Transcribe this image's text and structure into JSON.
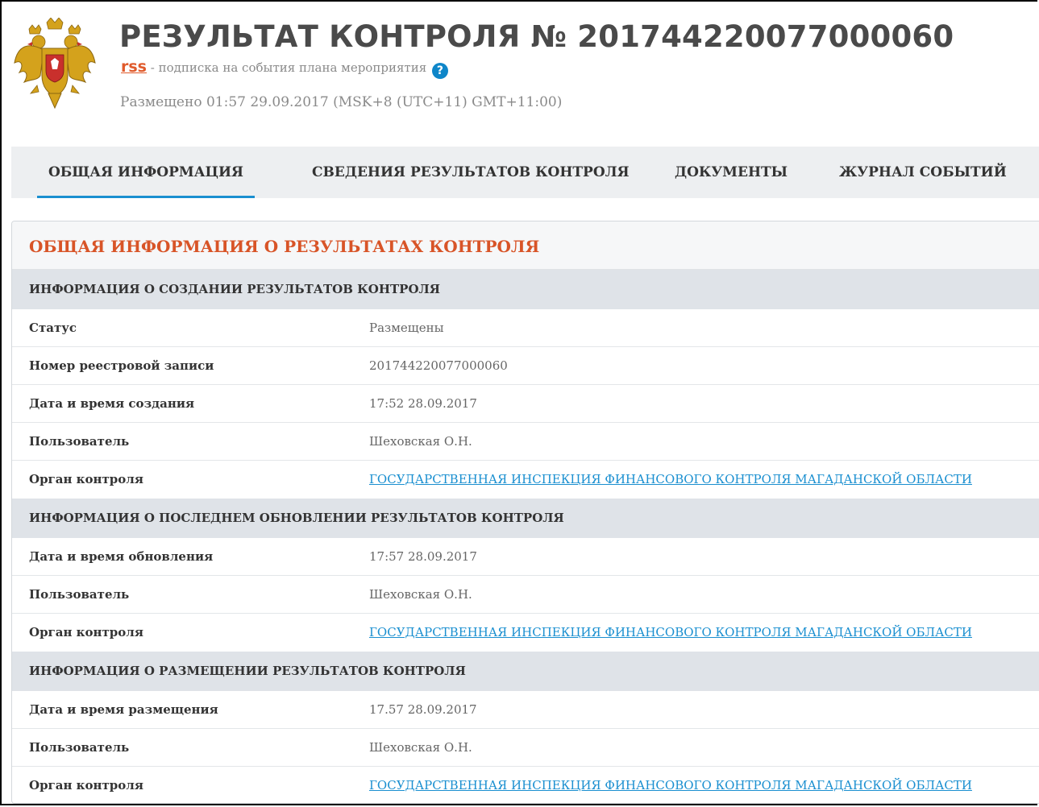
{
  "header": {
    "title": "РЕЗУЛЬТАТ КОНТРОЛЯ № 201744220077000060",
    "rss_label": "rss",
    "rss_description": " - подписка на события плана мероприятия",
    "help_icon_glyph": "?",
    "posted": "Размещено 01:57 29.09.2017 (MSK+8 (UTC+11) GMT+11:00)"
  },
  "tabs": [
    {
      "label": "ОБЩАЯ ИНФОРМАЦИЯ",
      "active": true
    },
    {
      "label": "СВЕДЕНИЯ РЕЗУЛЬТАТОВ КОНТРОЛЯ",
      "active": false
    },
    {
      "label": "ДОКУМЕНТЫ",
      "active": false
    },
    {
      "label": "ЖУРНАЛ СОБЫТИЙ",
      "active": false
    }
  ],
  "card": {
    "title": "ОБЩАЯ ИНФОРМАЦИЯ О РЕЗУЛЬТАТАХ КОНТРОЛЯ",
    "sections": [
      {
        "title": "ИНФОРМАЦИЯ О СОЗДАНИИ РЕЗУЛЬТАТОВ КОНТРОЛЯ",
        "rows": [
          {
            "label": "Статус",
            "value": "Размещены"
          },
          {
            "label": "Номер реестровой записи",
            "value": "201744220077000060"
          },
          {
            "label": "Дата и время создания",
            "value": "17:52 28.09.2017"
          },
          {
            "label": "Пользователь",
            "value": "Шеховская О.Н."
          },
          {
            "label": "Орган контроля",
            "value": "ГОСУДАРСТВЕННАЯ ИНСПЕКЦИЯ ФИНАНСОВОГО КОНТРОЛЯ МАГАДАНСКОЙ ОБЛАСТИ"
          }
        ]
      },
      {
        "title": "ИНФОРМАЦИЯ О ПОСЛЕДНЕМ ОБНОВЛЕНИИ РЕЗУЛЬТАТОВ КОНТРОЛЯ",
        "rows": [
          {
            "label": "Дата и время обновления",
            "value": "17:57 28.09.2017"
          },
          {
            "label": "Пользователь",
            "value": "Шеховская О.Н."
          },
          {
            "label": "Орган контроля",
            "value": "ГОСУДАРСТВЕННАЯ ИНСПЕКЦИЯ ФИНАНСОВОГО КОНТРОЛЯ МАГАДАНСКОЙ ОБЛАСТИ"
          }
        ]
      },
      {
        "title": "ИНФОРМАЦИЯ О РАЗМЕЩЕНИИ РЕЗУЛЬТАТОВ КОНТРОЛЯ",
        "rows": [
          {
            "label": "Дата и время размещения",
            "value": "17.57 28.09.2017"
          },
          {
            "label": "Пользователь",
            "value": "Шеховская О.Н."
          },
          {
            "label": "Орган контроля",
            "value": "ГОСУДАРСТВЕННАЯ ИНСПЕКЦИЯ ФИНАНСОВОГО КОНТРОЛЯ МАГАДАНСКОЙ ОБЛАСТИ"
          }
        ]
      }
    ]
  },
  "colors": {
    "accent": "#d85427",
    "link": "#1a8fd0",
    "rss": "#e05a2b",
    "section_bg": "#dfe3e8",
    "tabs_bg": "#edeff1"
  },
  "icons": {
    "emblem": "russian-coat-of-arms",
    "help": "question-circle-icon"
  }
}
